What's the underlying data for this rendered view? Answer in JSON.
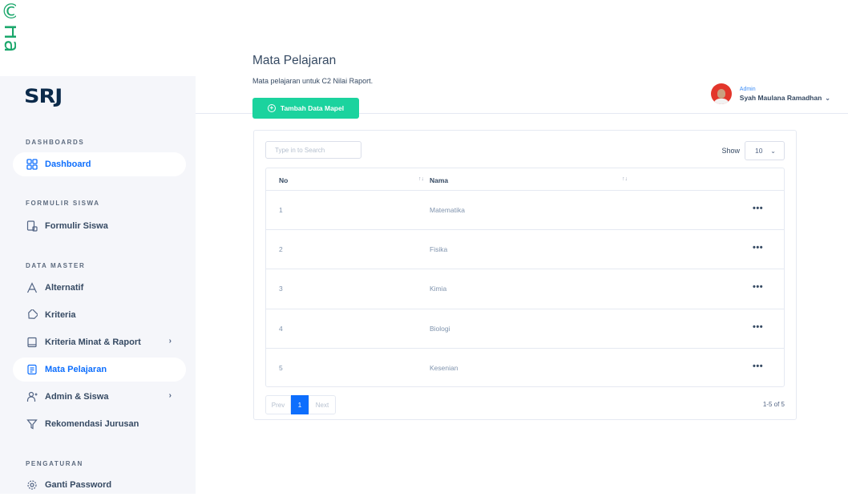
{
  "edge_strip": {
    "text": "©Ha"
  },
  "sidebar": {
    "logo": "SRJ",
    "sections": [
      {
        "heading": "DASHBOARDS"
      },
      {
        "heading": "FORMULIR SISWA"
      },
      {
        "heading": "DATA MASTER"
      },
      {
        "heading": "PENGATURAN"
      }
    ],
    "items": [
      {
        "label": "Dashboard",
        "icon": "grid-icon"
      },
      {
        "label": "Formulir Siswa",
        "icon": "form-icon"
      },
      {
        "label": "Alternatif",
        "icon": "letter-a-icon"
      },
      {
        "label": "Kriteria",
        "icon": "tag-icon"
      },
      {
        "label": "Kriteria Minat & Raport",
        "icon": "book-icon",
        "chevron": "›"
      },
      {
        "label": "Mata Pelajaran",
        "icon": "notebook-icon"
      },
      {
        "label": "Admin & Siswa",
        "icon": "users-add-icon",
        "chevron": "›"
      },
      {
        "label": "Rekomendasi Jurusan",
        "icon": "filter-icon"
      },
      {
        "label": "Ganti Password",
        "icon": "gear-icon"
      }
    ]
  },
  "header": {
    "user_role": "Admin",
    "user_name": "Syah Maulana Ramadhan",
    "chevron": "⌄"
  },
  "main": {
    "title": "Mata Pelajaran",
    "subtitle": "Mata pelajaran untuk C2 Nilai Raport.",
    "add_button": "Tambah Data Mapel",
    "search_placeholder": "Type in to Search",
    "show_label": "Show",
    "show_value": "10",
    "table": {
      "columns": [
        "No",
        "Nama"
      ],
      "rows": [
        {
          "no": "1",
          "nama": "Matematika"
        },
        {
          "no": "2",
          "nama": "Fisika"
        },
        {
          "no": "3",
          "nama": "Kimia"
        },
        {
          "no": "4",
          "nama": "Biologi"
        },
        {
          "no": "5",
          "nama": "Kesenian"
        }
      ],
      "more_glyph": "•••"
    },
    "pagination": {
      "prev": "Prev",
      "current": "1",
      "next": "Next",
      "count": "1-5 of 5"
    }
  },
  "colors": {
    "accent": "#0d6efd",
    "success": "#1bd39e",
    "sidebar_bg": "#f5f6fa",
    "avatar_bg": "#e3362b"
  }
}
